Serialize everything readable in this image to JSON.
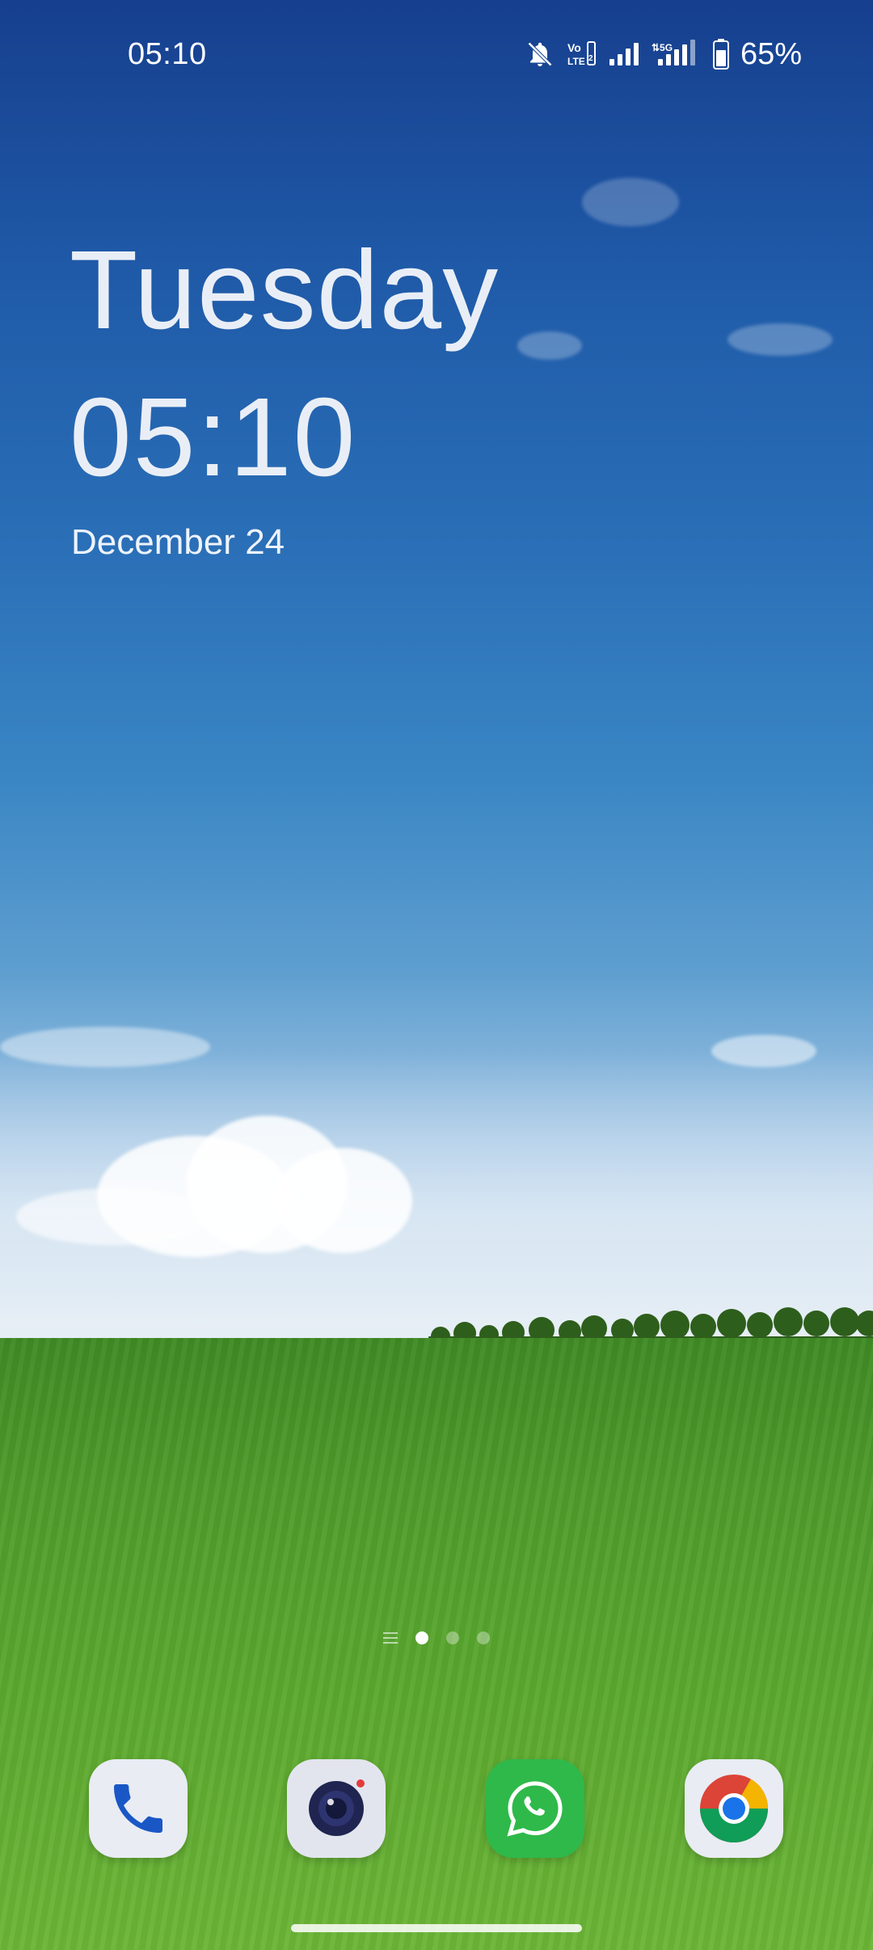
{
  "status_bar": {
    "time": "05:10",
    "battery_percent": "65%",
    "network_badges": [
      "Vo LTE 2",
      "5G"
    ],
    "icons": [
      "mute-bell-icon",
      "volte-icon",
      "signal-bars-icon",
      "5g-signal-icon",
      "battery-icon"
    ]
  },
  "home_clock": {
    "day": "Tuesday",
    "time": "05:10",
    "date": "December 24"
  },
  "pager": {
    "pages": 3,
    "active_index": 0
  },
  "dock": {
    "apps": [
      {
        "name": "Phone",
        "icon": "phone-icon"
      },
      {
        "name": "Camera",
        "icon": "camera-icon"
      },
      {
        "name": "WhatsApp",
        "icon": "whatsapp-icon"
      },
      {
        "name": "Chrome",
        "icon": "chrome-icon"
      }
    ]
  },
  "colors": {
    "sky_top": "#163f8e",
    "grass": "#4f9b2b",
    "whatsapp_green": "#2fb94a"
  }
}
